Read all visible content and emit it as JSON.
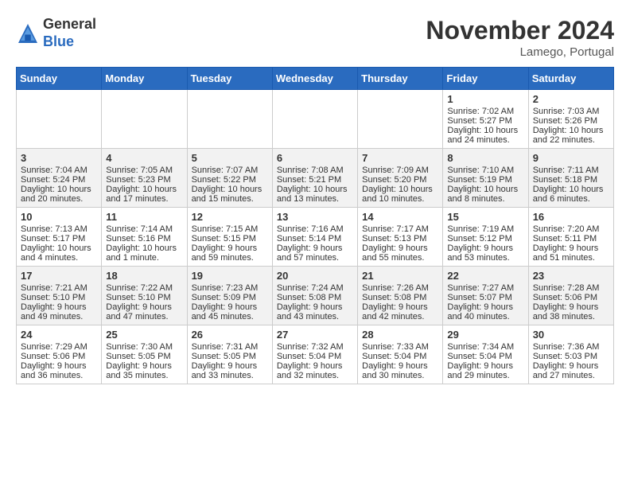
{
  "header": {
    "logo_general": "General",
    "logo_blue": "Blue",
    "month_title": "November 2024",
    "location": "Lamego, Portugal"
  },
  "weekdays": [
    "Sunday",
    "Monday",
    "Tuesday",
    "Wednesday",
    "Thursday",
    "Friday",
    "Saturday"
  ],
  "weeks": [
    [
      {
        "day": "",
        "info": ""
      },
      {
        "day": "",
        "info": ""
      },
      {
        "day": "",
        "info": ""
      },
      {
        "day": "",
        "info": ""
      },
      {
        "day": "",
        "info": ""
      },
      {
        "day": "1",
        "info": "Sunrise: 7:02 AM\nSunset: 5:27 PM\nDaylight: 10 hours and 24 minutes."
      },
      {
        "day": "2",
        "info": "Sunrise: 7:03 AM\nSunset: 5:26 PM\nDaylight: 10 hours and 22 minutes."
      }
    ],
    [
      {
        "day": "3",
        "info": "Sunrise: 7:04 AM\nSunset: 5:24 PM\nDaylight: 10 hours and 20 minutes."
      },
      {
        "day": "4",
        "info": "Sunrise: 7:05 AM\nSunset: 5:23 PM\nDaylight: 10 hours and 17 minutes."
      },
      {
        "day": "5",
        "info": "Sunrise: 7:07 AM\nSunset: 5:22 PM\nDaylight: 10 hours and 15 minutes."
      },
      {
        "day": "6",
        "info": "Sunrise: 7:08 AM\nSunset: 5:21 PM\nDaylight: 10 hours and 13 minutes."
      },
      {
        "day": "7",
        "info": "Sunrise: 7:09 AM\nSunset: 5:20 PM\nDaylight: 10 hours and 10 minutes."
      },
      {
        "day": "8",
        "info": "Sunrise: 7:10 AM\nSunset: 5:19 PM\nDaylight: 10 hours and 8 minutes."
      },
      {
        "day": "9",
        "info": "Sunrise: 7:11 AM\nSunset: 5:18 PM\nDaylight: 10 hours and 6 minutes."
      }
    ],
    [
      {
        "day": "10",
        "info": "Sunrise: 7:13 AM\nSunset: 5:17 PM\nDaylight: 10 hours and 4 minutes."
      },
      {
        "day": "11",
        "info": "Sunrise: 7:14 AM\nSunset: 5:16 PM\nDaylight: 10 hours and 1 minute."
      },
      {
        "day": "12",
        "info": "Sunrise: 7:15 AM\nSunset: 5:15 PM\nDaylight: 9 hours and 59 minutes."
      },
      {
        "day": "13",
        "info": "Sunrise: 7:16 AM\nSunset: 5:14 PM\nDaylight: 9 hours and 57 minutes."
      },
      {
        "day": "14",
        "info": "Sunrise: 7:17 AM\nSunset: 5:13 PM\nDaylight: 9 hours and 55 minutes."
      },
      {
        "day": "15",
        "info": "Sunrise: 7:19 AM\nSunset: 5:12 PM\nDaylight: 9 hours and 53 minutes."
      },
      {
        "day": "16",
        "info": "Sunrise: 7:20 AM\nSunset: 5:11 PM\nDaylight: 9 hours and 51 minutes."
      }
    ],
    [
      {
        "day": "17",
        "info": "Sunrise: 7:21 AM\nSunset: 5:10 PM\nDaylight: 9 hours and 49 minutes."
      },
      {
        "day": "18",
        "info": "Sunrise: 7:22 AM\nSunset: 5:10 PM\nDaylight: 9 hours and 47 minutes."
      },
      {
        "day": "19",
        "info": "Sunrise: 7:23 AM\nSunset: 5:09 PM\nDaylight: 9 hours and 45 minutes."
      },
      {
        "day": "20",
        "info": "Sunrise: 7:24 AM\nSunset: 5:08 PM\nDaylight: 9 hours and 43 minutes."
      },
      {
        "day": "21",
        "info": "Sunrise: 7:26 AM\nSunset: 5:08 PM\nDaylight: 9 hours and 42 minutes."
      },
      {
        "day": "22",
        "info": "Sunrise: 7:27 AM\nSunset: 5:07 PM\nDaylight: 9 hours and 40 minutes."
      },
      {
        "day": "23",
        "info": "Sunrise: 7:28 AM\nSunset: 5:06 PM\nDaylight: 9 hours and 38 minutes."
      }
    ],
    [
      {
        "day": "24",
        "info": "Sunrise: 7:29 AM\nSunset: 5:06 PM\nDaylight: 9 hours and 36 minutes."
      },
      {
        "day": "25",
        "info": "Sunrise: 7:30 AM\nSunset: 5:05 PM\nDaylight: 9 hours and 35 minutes."
      },
      {
        "day": "26",
        "info": "Sunrise: 7:31 AM\nSunset: 5:05 PM\nDaylight: 9 hours and 33 minutes."
      },
      {
        "day": "27",
        "info": "Sunrise: 7:32 AM\nSunset: 5:04 PM\nDaylight: 9 hours and 32 minutes."
      },
      {
        "day": "28",
        "info": "Sunrise: 7:33 AM\nSunset: 5:04 PM\nDaylight: 9 hours and 30 minutes."
      },
      {
        "day": "29",
        "info": "Sunrise: 7:34 AM\nSunset: 5:04 PM\nDaylight: 9 hours and 29 minutes."
      },
      {
        "day": "30",
        "info": "Sunrise: 7:36 AM\nSunset: 5:03 PM\nDaylight: 9 hours and 27 minutes."
      }
    ]
  ]
}
